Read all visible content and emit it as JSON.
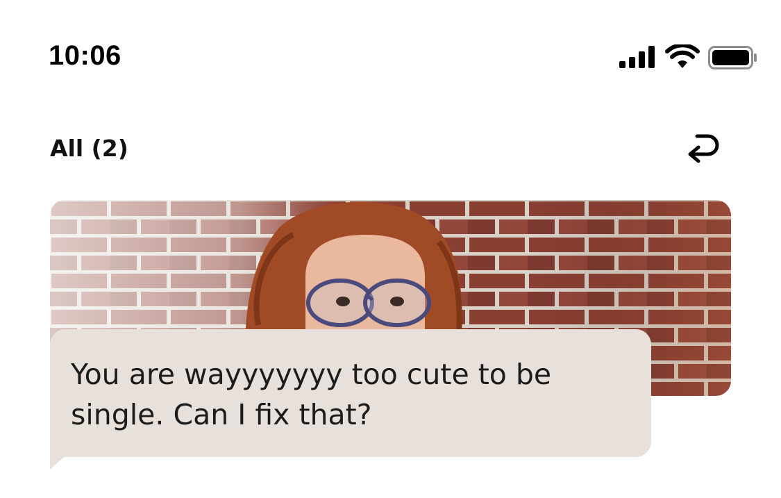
{
  "status_bar": {
    "time": "10:06",
    "icons": [
      "cellular-signal-icon",
      "wifi-icon",
      "battery-icon"
    ]
  },
  "header": {
    "filter_label": "All (2)",
    "undo_icon": "undo-arrow-icon"
  },
  "card": {
    "photo_alt": "profile-photo",
    "message": "You are wayyyyyyy too cute to be single. Can I fix that?"
  },
  "colors": {
    "bubble_bg": "#e8e1db",
    "text": "#1c1c1c",
    "brick": "#8a3f33",
    "hair": "#a04a26"
  }
}
